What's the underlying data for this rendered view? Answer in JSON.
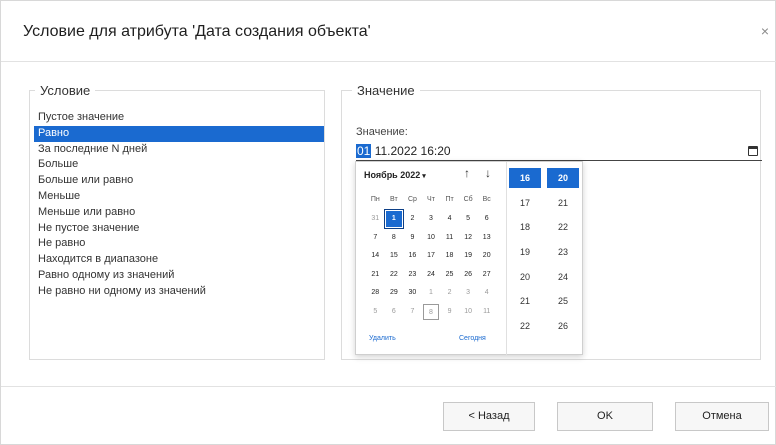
{
  "dialog": {
    "title": "Условие для атрибута 'Дата создания объекта'",
    "close_glyph": "×"
  },
  "condition": {
    "legend": "Условие",
    "items": [
      {
        "label": "Пустое значение"
      },
      {
        "label": "Равно",
        "selected": true
      },
      {
        "label": "За последние N дней"
      },
      {
        "label": "Больше"
      },
      {
        "label": "Больше или равно"
      },
      {
        "label": "Меньше"
      },
      {
        "label": "Меньше или равно"
      },
      {
        "label": "Не пустое значение"
      },
      {
        "label": "Не равно"
      },
      {
        "label": "Находится в диапазоне"
      },
      {
        "label": "Равно одному из значений"
      },
      {
        "label": "Не равно ни одному из значений"
      }
    ]
  },
  "value": {
    "legend": "Значение",
    "label": "Значение:",
    "input_selected_part": "01",
    "input_rest": " 11.2022 16:20"
  },
  "calendar": {
    "month_label": "Ноябрь 2022",
    "caret": "▾",
    "nav_up": "↑",
    "nav_down": "↓",
    "weekdays": [
      "Пн",
      "Вт",
      "Ср",
      "Чт",
      "Пт",
      "Сб",
      "Вс"
    ],
    "days": [
      {
        "d": "31",
        "other": true
      },
      {
        "d": "1",
        "selected": true
      },
      {
        "d": "2"
      },
      {
        "d": "3"
      },
      {
        "d": "4"
      },
      {
        "d": "5"
      },
      {
        "d": "6"
      },
      {
        "d": "7"
      },
      {
        "d": "8"
      },
      {
        "d": "9"
      },
      {
        "d": "10"
      },
      {
        "d": "11"
      },
      {
        "d": "12"
      },
      {
        "d": "13"
      },
      {
        "d": "14"
      },
      {
        "d": "15"
      },
      {
        "d": "16"
      },
      {
        "d": "17"
      },
      {
        "d": "18"
      },
      {
        "d": "19"
      },
      {
        "d": "20"
      },
      {
        "d": "21"
      },
      {
        "d": "22"
      },
      {
        "d": "23"
      },
      {
        "d": "24"
      },
      {
        "d": "25"
      },
      {
        "d": "26"
      },
      {
        "d": "27"
      },
      {
        "d": "28"
      },
      {
        "d": "29"
      },
      {
        "d": "30"
      },
      {
        "d": "1",
        "other": true
      },
      {
        "d": "2",
        "other": true
      },
      {
        "d": "3",
        "other": true
      },
      {
        "d": "4",
        "other": true
      },
      {
        "d": "5",
        "other": true
      },
      {
        "d": "6",
        "other": true
      },
      {
        "d": "7",
        "other": true
      },
      {
        "d": "8",
        "other": true,
        "today": true
      },
      {
        "d": "9",
        "other": true
      },
      {
        "d": "10",
        "other": true
      },
      {
        "d": "11",
        "other": true
      }
    ],
    "delete_label": "Удалить",
    "today_label": "Сегодня",
    "hours": [
      {
        "v": "16",
        "selected": true
      },
      {
        "v": "17"
      },
      {
        "v": "18"
      },
      {
        "v": "19"
      },
      {
        "v": "20"
      },
      {
        "v": "21"
      },
      {
        "v": "22"
      }
    ],
    "minutes": [
      {
        "v": "20",
        "selected": true
      },
      {
        "v": "21"
      },
      {
        "v": "22"
      },
      {
        "v": "23"
      },
      {
        "v": "24"
      },
      {
        "v": "25"
      },
      {
        "v": "26"
      }
    ]
  },
  "buttons": {
    "back": "< Назад",
    "ok": "OK",
    "cancel": "Отмена"
  },
  "colors": {
    "accent": "#1a6ad0"
  }
}
